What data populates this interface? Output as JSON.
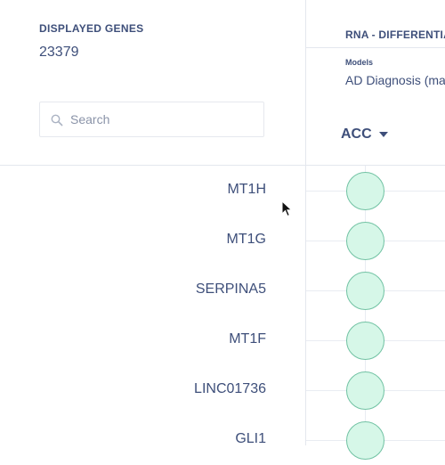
{
  "genes_panel": {
    "title": "DISPLAYED GENES",
    "count": "23379"
  },
  "search": {
    "placeholder": "Search",
    "value": ""
  },
  "rna_panel": {
    "title": "RNA - DIFFERENTIAL EXPRESSION",
    "models_label": "Models",
    "model_value": "AD Diagnosis (males and females)",
    "tissue": "ACC"
  },
  "genes": [
    {
      "name": "MT1H"
    },
    {
      "name": "MT1G"
    },
    {
      "name": "SERPINA5"
    },
    {
      "name": "MT1F"
    },
    {
      "name": "LINC01736"
    },
    {
      "name": "GLI1"
    }
  ],
  "colors": {
    "text": "#3e4f7a",
    "dot_fill": "#d6f7e8",
    "dot_border": "#71c2a3",
    "divider": "#e4e7ee"
  },
  "icons": {
    "search": "search-icon",
    "dropdown": "caret-down-icon",
    "cursor": "mouse-pointer-icon"
  }
}
